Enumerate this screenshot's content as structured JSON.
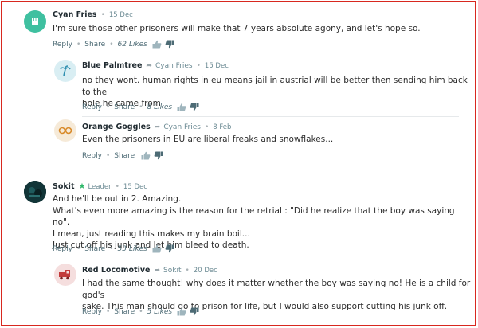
{
  "colors": {
    "accent": "#6b8a93",
    "border": "#d8281f",
    "leader_star": "#2fb86a"
  },
  "comments": [
    {
      "author": "Cyan Fries",
      "date": "15 Dec",
      "text": "I'm sure those other prisoners will make that 7 years absolute agony, and let's hope so.",
      "reply": "Reply",
      "share": "Share",
      "likes": "62 Likes",
      "avatar_icon": "fist-icon"
    },
    {
      "author": "Blue Palmtree",
      "reply_to": "Cyan Fries",
      "date": "15 Dec",
      "text_lines": [
        "no they wont. human rights in eu means jail in austrial will be better then sending him back to the",
        "hole he came from"
      ],
      "reply": "Reply",
      "share": "Share",
      "likes": "8 Likes",
      "avatar_icon": "palm-tree-icon"
    },
    {
      "author": "Orange Goggles",
      "reply_to": "Cyan Fries",
      "date": "8 Feb",
      "text": "Even the prisoners in EU are liberal freaks and snowflakes...",
      "reply": "Reply",
      "share": "Share",
      "avatar_icon": "goggles-icon"
    },
    {
      "author": "Sokit",
      "badge": "Leader",
      "date": "15 Dec",
      "text_lines": [
        "And he'll be out in 2. Amazing.",
        "What's even more amazing is the reason for the retrial : \"Did he realize that the boy was saying no\".",
        "I mean, just reading this makes my brain boil...",
        "Just cut off his junk and let him bleed to death."
      ],
      "reply": "Reply",
      "share": "Share",
      "likes": "53 Likes",
      "avatar_icon": "user-photo-avatar"
    },
    {
      "author": "Red Locomotive",
      "reply_to": "Sokit",
      "date": "20 Dec",
      "text_lines": [
        "I had the same thought! why does it matter whether the boy was saying no! He is a child for god's",
        "sake. This man should go to prison for life, but I would also support cutting his junk off."
      ],
      "reply": "Reply",
      "share": "Share",
      "likes": "5 Likes",
      "avatar_icon": "locomotive-icon"
    }
  ]
}
